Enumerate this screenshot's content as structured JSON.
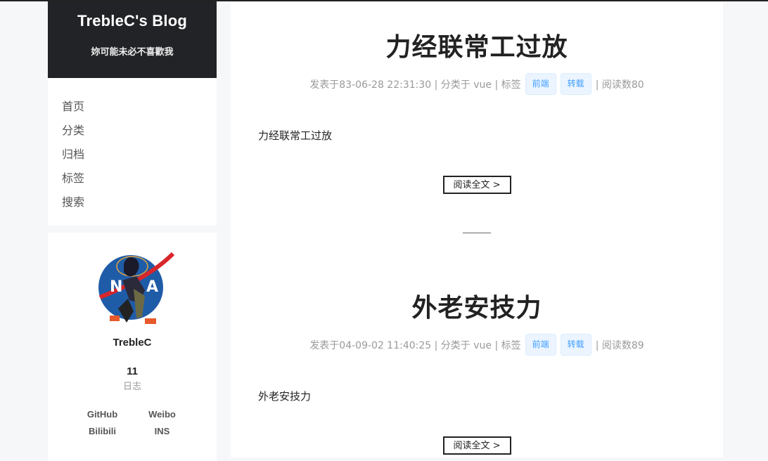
{
  "site": {
    "title": "TrebleC's Blog",
    "subtitle": "妳可能未必不喜歡我"
  },
  "menu": [
    {
      "label": "首页"
    },
    {
      "label": "分类"
    },
    {
      "label": "归档"
    },
    {
      "label": "标签"
    },
    {
      "label": "搜索"
    }
  ],
  "profile": {
    "name": "TrebleC",
    "posts_count": "11",
    "posts_label": "日志",
    "links": [
      "GitHub",
      "Weibo",
      "Bilibili",
      "INS"
    ]
  },
  "posts": [
    {
      "title": "力经联常工过放",
      "meta_prefix": "发表于83-06-28 22:31:30 | 分类于 vue | 标签",
      "tags": [
        "前端",
        "转载"
      ],
      "meta_suffix": "| 阅读数80",
      "excerpt": "力经联常工过放",
      "read_more": "阅读全文 >"
    },
    {
      "title": "外老安技力",
      "meta_prefix": "发表于04-09-02 11:40:25 | 分类于 vue | 标签",
      "tags": [
        "前端",
        "转载"
      ],
      "meta_suffix": "| 阅读数89",
      "excerpt": "外老安技力",
      "read_more": "阅读全文 >"
    }
  ],
  "colors": {
    "header_bg": "#222326",
    "tag_text": "#409eff",
    "tag_bg": "#ecf5ff",
    "page_bg": "#f5f7f9"
  }
}
